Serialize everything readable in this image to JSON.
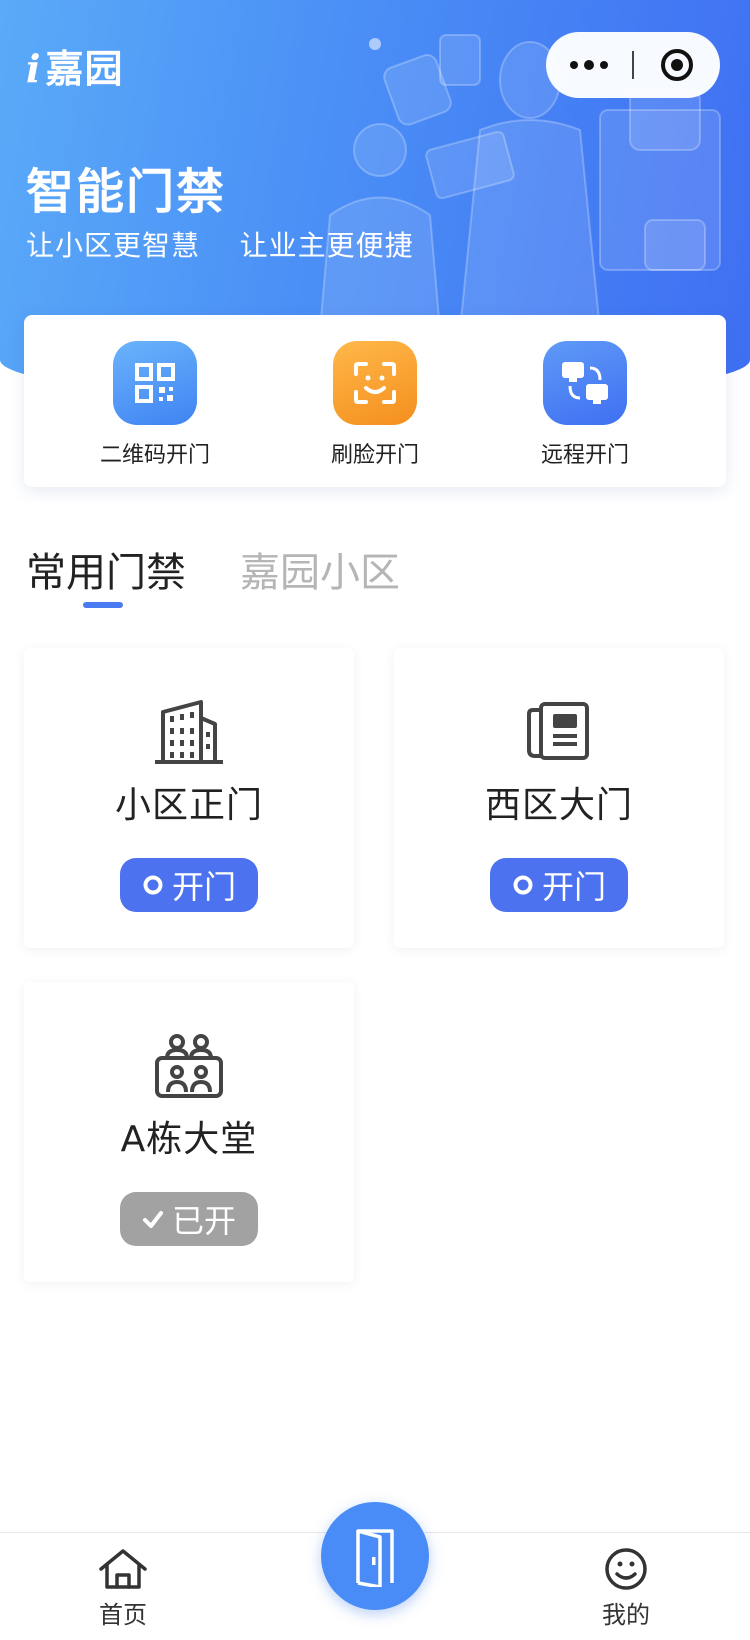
{
  "header": {
    "brand_mark": "i",
    "brand_name": "嘉园",
    "title": "智能门禁",
    "subtitle": "让小区更智慧    让业主更便捷"
  },
  "capsule": {
    "more_icon": "more-dots-icon",
    "close_icon": "target-icon"
  },
  "quick_actions": [
    {
      "label": "二维码开门",
      "icon": "qrcode-icon",
      "color": "#4a90f5"
    },
    {
      "label": "刷脸开门",
      "icon": "face-scan-icon",
      "color": "#f7a02e"
    },
    {
      "label": "远程开门",
      "icon": "remote-network-icon",
      "color": "#4b7af2"
    }
  ],
  "tabs": [
    {
      "label": "常用门禁",
      "active": true
    },
    {
      "label": "嘉园小区",
      "active": false
    }
  ],
  "doors": [
    {
      "name": "小区正门",
      "icon": "building-icon",
      "button": "开门",
      "status": "closed"
    },
    {
      "name": "西区大门",
      "icon": "intercom-icon",
      "button": "开门",
      "status": "closed"
    },
    {
      "name": "A栋大堂",
      "icon": "lobby-people-icon",
      "button": "已开",
      "status": "opened"
    }
  ],
  "tabbar": {
    "home_label": "首页",
    "mine_label": "我的",
    "center_icon": "door-icon"
  },
  "colors": {
    "accent": "#4d72ef",
    "hero_start": "#5aaaf8",
    "hero_end": "#3f6ff2",
    "opened_gray": "#a2a2a2"
  }
}
